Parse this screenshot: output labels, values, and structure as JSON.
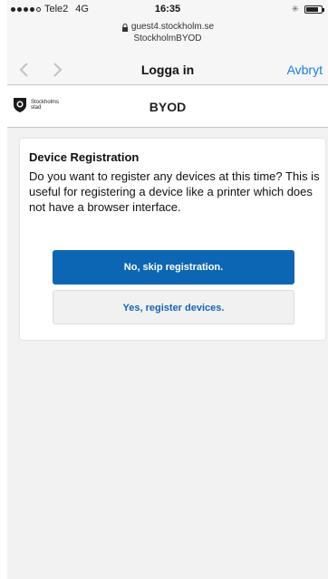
{
  "status_bar": {
    "carrier": "Tele2",
    "network": "4G",
    "time": "16:35",
    "bluetooth_icon": "bluetooth-icon",
    "battery_icon": "battery-icon"
  },
  "url_bar": {
    "lock_icon": "lock-icon",
    "url": "guest4.stockholm.se",
    "site_name": "StockholmBYOD"
  },
  "nav": {
    "back_icon": "chevron-left-icon",
    "forward_icon": "chevron-right-icon",
    "title": "Logga in",
    "cancel_label": "Avbryt"
  },
  "site_header": {
    "logo_text": "Stockholms stad",
    "title": "BYOD"
  },
  "registration": {
    "title": "Device Registration",
    "description": "Do you want to register any devices at this time? This is useful for registering a device like a printer which does not have a browser interface.",
    "skip_label": "No, skip registration.",
    "register_label": "Yes, register devices."
  },
  "colors": {
    "primary_button": "#0d66b3",
    "link_blue": "#1a7ee6",
    "page_background": "#f2f2f2"
  }
}
